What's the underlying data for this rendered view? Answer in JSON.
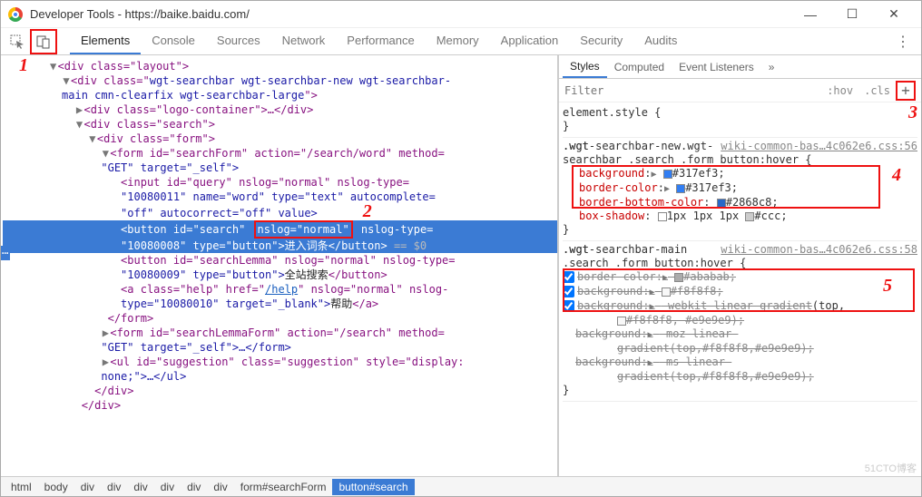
{
  "window": {
    "title": "Developer Tools - https://baike.baidu.com/"
  },
  "tabs": [
    "Elements",
    "Console",
    "Sources",
    "Network",
    "Performance",
    "Memory",
    "Application",
    "Security",
    "Audits"
  ],
  "annotations": {
    "n1": "1",
    "n2": "2",
    "n3": "3",
    "n4": "4",
    "n5": "5"
  },
  "dom": {
    "l1": "<div class=\"layout\">",
    "l2a": "<div class=\"",
    "l2b": "wgt-searchbar wgt-searchbar-new wgt-searchbar-",
    "l2c": "main cmn-clearfix wgt-searchbar-large",
    "l2d": "\">",
    "l3": "<div class=\"logo-container\">…</div>",
    "l4": "<div class=\"search\">",
    "l5": "<div class=\"form\">",
    "l6a": "<form id=\"searchForm\" action=\"/search/word\" method=",
    "l6b": "\"GET\" target=\"_self\">",
    "l7a": "<input id=\"query\" nslog=\"normal\" nslog-type=",
    "l7b": "\"10080011\" name=\"word\" type=\"text\" autocomplete=",
    "l7c": "\"off\" autocorrect=\"off\" value>",
    "sel_a": "<button id=\"search\" ",
    "sel_box": "nslog=\"normal\"",
    "sel_b": " nslog-type=",
    "sel_c": "\"10080008\" type=\"button\">",
    "sel_txt": "进入词条",
    "sel_d": "</button>",
    "sel_hint": " == $0",
    "l9a": "<button id=\"searchLemma\" nslog=\"normal\" nslog-type=",
    "l9b": "\"10080009\" type=\"button\">",
    "l9txt": "全站搜索",
    "l9c": "</button>",
    "l10a": "<a class=\"help\" href=\"",
    "l10href": "/help",
    "l10b": "\" nslog=\"normal\" nslog-",
    "l10c": "type=\"10080010\" target=\"_blank\">",
    "l10txt": "帮助",
    "l10d": "</a>",
    "l11": "</form>",
    "l12a": "<form id=\"searchLemmaForm\" action=\"/search\" method=",
    "l12b": "\"GET\" target=\"_self\">…</form>",
    "l13a": "<ul id=\"suggestion\" class=\"suggestion\" style=\"display:",
    "l13b": "none;\">…</ul>",
    "l14": "</div>",
    "l15": "</div>"
  },
  "styles": {
    "tabs": [
      "Styles",
      "Computed",
      "Event Listeners"
    ],
    "filter_ph": "Filter",
    "hov": ":hov",
    "cls": ".cls",
    "src1": "wiki-common-bas…4c062e6.css:56",
    "sel1": ".wgt-searchbar-new.wgt-searchbar .search .form button:hover {",
    "p1": "background",
    "v1": "#317ef3",
    "c1": "#317ef3",
    "p2": "border-color",
    "v2": "#317ef3",
    "c2": "#317ef3",
    "p3": "border-bottom-color",
    "v3": "#2868c8",
    "c3": "#2868c8",
    "p4": "box-shadow",
    "v4a": "1px 1px 1px ",
    "v4b": "#ccc",
    "c4a": "#ffffff",
    "c4b": "#cccccc",
    "src2": "wiki-common-bas…4c062e6.css:58",
    "sel2": ".wgt-searchbar-main .search .form button:hover {",
    "s1p": "border-color",
    "s1v": "#ababab",
    "s1c": "#ababab",
    "s2p": "background",
    "s2v": "#f8f8f8",
    "s2c": "#f8f8f8",
    "s3p": "background",
    "s3v": "-webkit-linear-gradient",
    "s3tail": "(top,",
    "s3b": "#f8f8f8,   #e9e9e9);",
    "s4p": "background",
    "s4v": "-moz-linear-gradient(top,#f8f8f8,#e9e9e9);",
    "s5p": "background",
    "s5v": "-ms-linear-gradient(top,#f8f8f8,#e9e9e9);"
  },
  "crumbs": [
    "html",
    "body",
    "div",
    "div",
    "div",
    "div",
    "div",
    "div",
    "form#searchForm",
    "button#search"
  ],
  "watermark": "51CTO博客"
}
